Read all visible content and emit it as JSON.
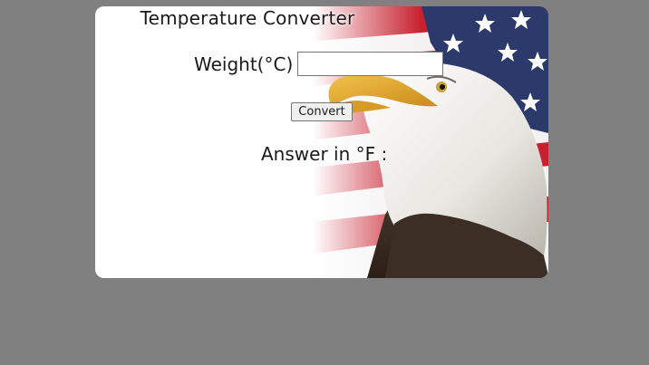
{
  "page": {
    "background_color": "#808080",
    "card_color": "#ffffff"
  },
  "title": "Temperature Converter",
  "form": {
    "label": "Weight(°C)",
    "input_value": "",
    "input_placeholder": "",
    "button_label": "Convert"
  },
  "result": {
    "label": "Answer in °F :",
    "value": ""
  },
  "background_image": {
    "description_icon": "eagle-flag-image",
    "colors": {
      "flag_red": "#c8202e",
      "flag_blue": "#2b3a6b",
      "beak": "#e0a020"
    }
  }
}
